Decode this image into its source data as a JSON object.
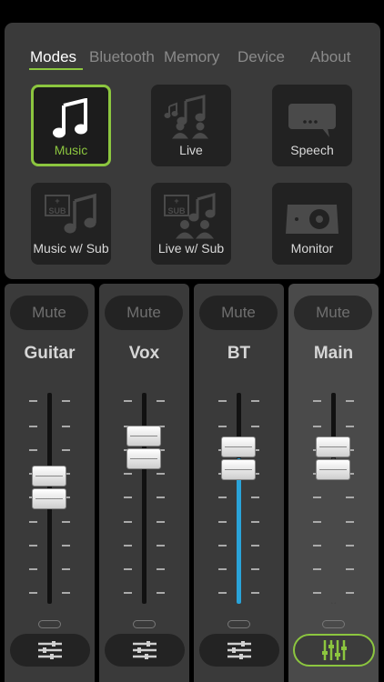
{
  "tabs": [
    {
      "label": "Modes",
      "active": true
    },
    {
      "label": "Bluetooth",
      "active": false
    },
    {
      "label": "Memory",
      "active": false
    },
    {
      "label": "Device",
      "active": false
    },
    {
      "label": "About",
      "active": false
    }
  ],
  "modes": [
    {
      "label": "Music",
      "icon": "music-note-icon",
      "active": true
    },
    {
      "label": "Live",
      "icon": "live-band-icon",
      "active": false
    },
    {
      "label": "Speech",
      "icon": "speech-bubble-icon",
      "active": false
    },
    {
      "label": "Music w/ Sub",
      "icon": "music-sub-icon",
      "active": false
    },
    {
      "label": "Live w/ Sub",
      "icon": "live-sub-icon",
      "active": false
    },
    {
      "label": "Monitor",
      "icon": "monitor-speaker-icon",
      "active": false
    }
  ],
  "icon_text": {
    "sub": "SUB",
    "plus": "+"
  },
  "channels": [
    {
      "name": "Guitar",
      "mute_label": "Mute",
      "fader_level": 0.55,
      "fill": "none",
      "eq_active": false
    },
    {
      "name": "Vox",
      "mute_label": "Mute",
      "fader_level": 0.74,
      "fill": "none",
      "eq_active": false
    },
    {
      "name": "BT",
      "mute_label": "Mute",
      "fader_level": 0.69,
      "fill": "blue",
      "eq_active": false
    },
    {
      "name": "Main",
      "mute_label": "Mute",
      "fader_level": 0.69,
      "fill": "gray",
      "eq_active": true
    }
  ],
  "colors": {
    "accent_green": "#8cc63f",
    "meter_blue": "#2aa3d9",
    "panel": "#3a3a3a",
    "button": "#222222"
  }
}
